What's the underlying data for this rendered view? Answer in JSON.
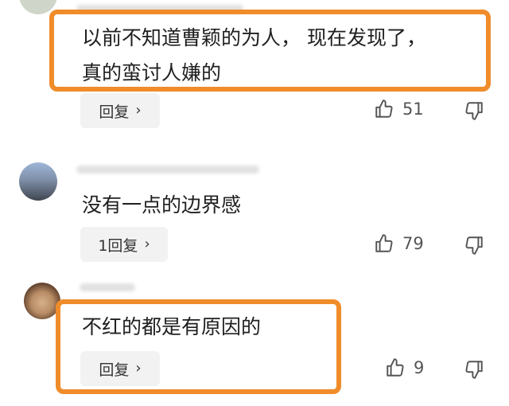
{
  "comments": [
    {
      "text_line1": "以前不知道曹颖的为人， 现在发现了，",
      "text_line2": "真的蛮讨人嫌的",
      "reply_label": "回复",
      "like_count": "51"
    },
    {
      "text_line1": "没有一点的边界感",
      "reply_label": "1回复",
      "like_count": "79"
    },
    {
      "text_line1": "不红的都是有原因的",
      "reply_label": "回复",
      "like_count": "9"
    }
  ],
  "colors": {
    "highlight": "#f08c2a",
    "reply_bg": "#f2f2f2"
  }
}
